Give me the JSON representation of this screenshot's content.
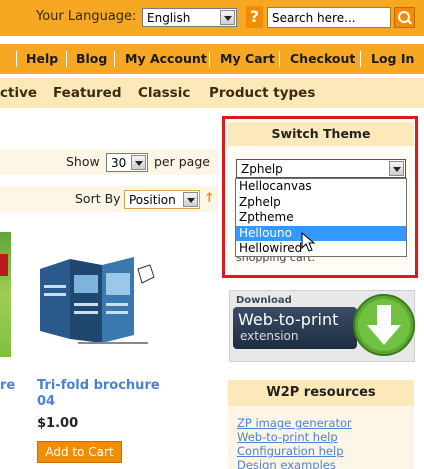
{
  "language_bar": {
    "label": "Your Language:",
    "selected": "English",
    "help_icon": "?",
    "search_placeholder": "Search here..."
  },
  "account_nav": [
    "Help",
    "Blog",
    "My Account",
    "My Cart",
    "Checkout",
    "Log In"
  ],
  "category_nav": [
    "ctive",
    "Featured",
    "Classic",
    "Product types"
  ],
  "toolbar": {
    "show_label": "Show",
    "show_value": "30",
    "per_page": "per page",
    "sort_label": "Sort By",
    "sort_value": "Position",
    "sort_direction_icon": "↑"
  },
  "products": {
    "left_partial_name": "re",
    "item": {
      "name": "Tri-fold brochure 04",
      "price": "$1.00",
      "add_to_cart": "Add to Cart"
    }
  },
  "switch_theme": {
    "title": "Switch Theme",
    "selected": "Zphelp",
    "options": [
      "Hellocanvas",
      "Zphelp",
      "Zptheme",
      "Hellouno",
      "Hellowired"
    ],
    "highlighted": "Hellouno",
    "hidden_text": "shopping cart."
  },
  "download": {
    "label": "Download",
    "title": "Web-to-print",
    "subtitle": "extension"
  },
  "w2p": {
    "title": "W2P resources",
    "links": [
      "ZP image generator",
      "Web-to-print help",
      "Configuration help",
      "Design examples"
    ]
  },
  "colors": {
    "orange": "#f7a823",
    "light_orange": "#fce8b8",
    "link_blue": "#4b82d4",
    "highlight_red": "#e0171d",
    "selection_blue": "#3399ff"
  }
}
